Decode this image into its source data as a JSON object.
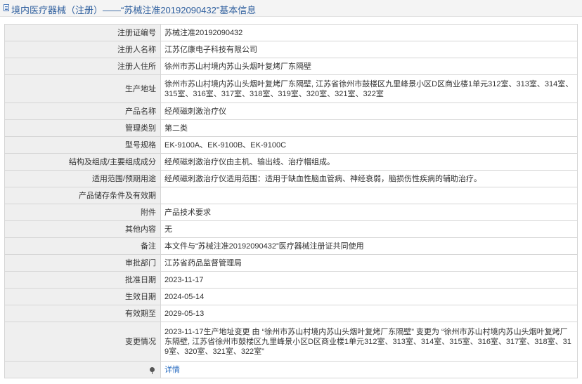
{
  "header": {
    "title": "境内医疗器械（注册）——“苏械注准20192090432”基本信息",
    "icon": "document-icon"
  },
  "rows": [
    {
      "label": "注册证编号",
      "value": "苏械注准20192090432"
    },
    {
      "label": "注册人名称",
      "value": "江苏亿康电子科技有限公司"
    },
    {
      "label": "注册人住所",
      "value": "徐州市苏山村境内苏山头烟叶复烤厂东隔壁"
    },
    {
      "label": "生产地址",
      "value": "徐州市苏山村境内苏山头烟叶复烤厂东隔壁, 江苏省徐州市鼓楼区九里峰景小区D区商业楼1单元312室、313室、314室、315室、316室、317室、318室、319室、320室、321室、322室"
    },
    {
      "label": "产品名称",
      "value": "经颅磁刺激治疗仪"
    },
    {
      "label": "管理类别",
      "value": "第二类"
    },
    {
      "label": "型号规格",
      "value": "EK-9100A、EK-9100B、EK-9100C"
    },
    {
      "label": "结构及组成/主要组成成分",
      "value": "经颅磁刺激治疗仪由主机、输出线、治疗帽组成。"
    },
    {
      "label": "适用范围/预期用途",
      "value": "经颅磁刺激治疗仪适用范围：适用于缺血性脑血管病、神经衰弱，脑损伤性疾病的辅助治疗。"
    },
    {
      "label": "产品储存条件及有效期",
      "value": ""
    },
    {
      "label": "附件",
      "value": "产品技术要求"
    },
    {
      "label": "其他内容",
      "value": "无"
    },
    {
      "label": "备注",
      "value": "本文件与“苏械注准20192090432”医疗器械注册证共同使用"
    },
    {
      "label": "审批部门",
      "value": "江苏省药品监督管理局"
    },
    {
      "label": "批准日期",
      "value": "2023-11-17"
    },
    {
      "label": "生效日期",
      "value": "2024-05-14"
    },
    {
      "label": "有效期至",
      "value": "2029-05-13"
    },
    {
      "label": "变更情况",
      "value": "2023-11-17生产地址变更 由 “徐州市苏山村境内苏山头烟叶复烤厂东隔壁” 变更为 “徐州市苏山村境内苏山头烟叶复烤厂东隔壁, 江苏省徐州市鼓楼区九里峰景小区D区商业楼1单元312室、313室、314室、315室、316室、317室、318室、319室、320室、321室、322室”"
    }
  ],
  "footer_row": {
    "label_icon": "pin-icon",
    "link_text": "详情"
  },
  "colors": {
    "title": "#2f5f9e",
    "label_bg": "#efefef",
    "border": "#d6d6d6",
    "link": "#2d6fc2"
  }
}
